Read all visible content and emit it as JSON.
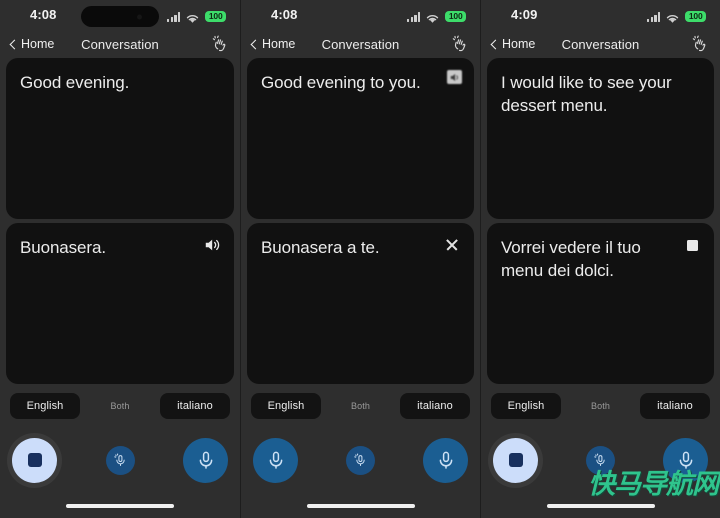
{
  "app": {
    "nav_title": "Conversation",
    "back_label": "Home",
    "gesture_icon": "wave-hand-icon"
  },
  "watermark": "快马导航网",
  "colors": {
    "panel_bg": "#2e2e2e",
    "card_bg": "#111111",
    "accent_blue": "#1b5e92",
    "stop_button_bg": "#ccddfa",
    "stop_square": "#18305e",
    "battery_green": "#3ddc6a",
    "watermark_green": "#2fc48d"
  },
  "panels": [
    {
      "status": {
        "time": "4:08",
        "battery": "100",
        "signal": "signal-bars-icon",
        "wifi": "wifi-icon",
        "island": true
      },
      "top_card": {
        "text": "Good evening.",
        "action_icon": "none"
      },
      "bottom_card": {
        "text": "Buonasera.",
        "action_icon": "speaker-icon"
      },
      "languages": {
        "left": "English",
        "middle": "Both",
        "right": "italiano"
      },
      "mic_row": {
        "left_button": "stop-button",
        "middle_button": "mic-small-button",
        "right_button": "mic-button"
      },
      "home_indicator": true
    },
    {
      "status": {
        "time": "4:08",
        "battery": "100",
        "signal": "signal-bars-icon",
        "wifi": "wifi-icon",
        "island": false
      },
      "top_card": {
        "text": "Good evening to you.",
        "action_icon": "speaker-icon-blurred"
      },
      "bottom_card": {
        "text": "Buonasera a te.",
        "action_icon": "close-icon"
      },
      "languages": {
        "left": "English",
        "middle": "Both",
        "right": "italiano"
      },
      "mic_row": {
        "left_button": "mic-button",
        "middle_button": "mic-small-button",
        "right_button": "mic-button"
      },
      "home_indicator": true
    },
    {
      "status": {
        "time": "4:09",
        "battery": "100",
        "signal": "signal-bars-icon",
        "wifi": "wifi-icon",
        "island": false
      },
      "top_card": {
        "text": "I would like to see your dessert menu.",
        "action_icon": "none"
      },
      "bottom_card": {
        "text": "Vorrei vedere il tuo menu dei dolci.",
        "action_icon": "stop-chip-icon"
      },
      "languages": {
        "left": "English",
        "middle": "Both",
        "right": "italiano"
      },
      "mic_row": {
        "left_button": "stop-button",
        "middle_button": "mic-small-button",
        "right_button": "mic-button"
      },
      "home_indicator": true
    }
  ]
}
